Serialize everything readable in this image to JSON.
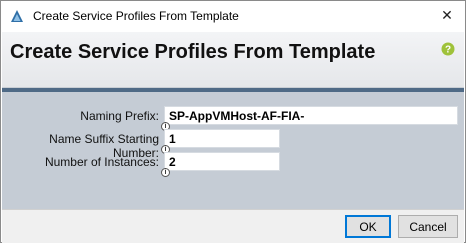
{
  "window": {
    "title": "Create Service Profiles From Template",
    "icon": "cisco-triangle-icon",
    "close_glyph": "✕"
  },
  "header": {
    "title": "Create Service Profiles From Template",
    "help_icon": "help-question-icon"
  },
  "form": {
    "naming_prefix": {
      "label": "Naming Prefix:",
      "value": "SP-AppVMHost-AF-FIA-"
    },
    "suffix_start": {
      "label": "Name Suffix Starting Number:",
      "value": "1"
    },
    "instances": {
      "label": "Number of Instances:",
      "value": "2"
    },
    "info_glyph": "i"
  },
  "buttons": {
    "ok": "OK",
    "cancel": "Cancel"
  },
  "colors": {
    "header_band": "#4f6a86",
    "form_background": "#c5ccd5",
    "help_icon": "#9fc23a",
    "primary_border": "#0078d7"
  }
}
